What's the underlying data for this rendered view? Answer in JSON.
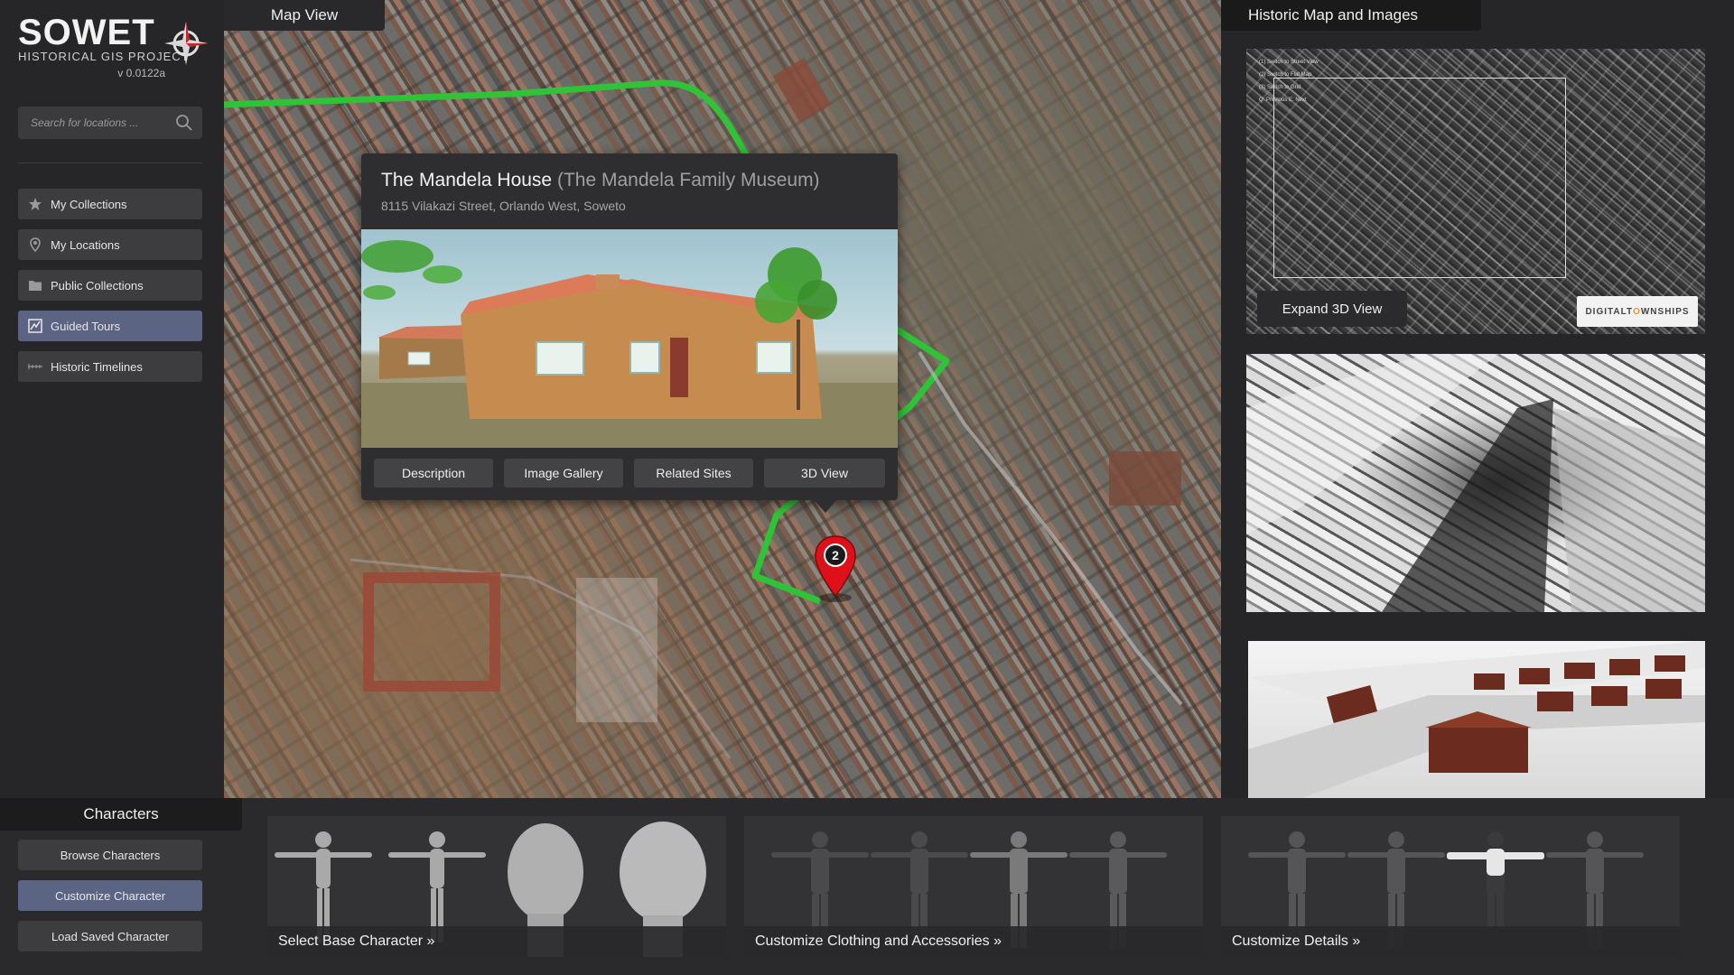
{
  "app": {
    "logo_title": "SOWET",
    "logo_subtitle": "HISTORICAL GIS PROJECT",
    "version": "v 0.0122a"
  },
  "search": {
    "placeholder": "Search for locations ..."
  },
  "sidebar": {
    "items": [
      {
        "label": "My Collections",
        "icon": "star-icon"
      },
      {
        "label": "My Locations",
        "icon": "map-pin-icon"
      },
      {
        "label": "Public Collections",
        "icon": "folder-icon"
      },
      {
        "label": "Guided Tours",
        "icon": "tour-icon",
        "active": true
      },
      {
        "label": "Historic Timelines",
        "icon": "timeline-icon"
      }
    ]
  },
  "map": {
    "tab_label": "Map View",
    "popup": {
      "title": "The Mandela House",
      "title_alt": "(The Mandela Family Museum)",
      "address": "8115 Vilakazi Street, Orlando West, Soweto",
      "tabs": [
        "Description",
        "Image Gallery",
        "Related Sites",
        "3D View"
      ]
    },
    "marker_number": "2",
    "route_color": "#2fc437"
  },
  "right_panel": {
    "title": "Historic Map  and Images",
    "expand_label": "Expand 3D View",
    "logo_text_a": "DIGITALT",
    "logo_text_o": "O",
    "logo_text_b": "WNSHIPS",
    "hints": [
      "(1) Switch to Street View",
      "(2) Switch to Flat Map",
      "(3) Switch to Grid",
      "Q: Previous      E: Next"
    ]
  },
  "characters": {
    "title": "Characters",
    "nav": [
      {
        "label": "Browse Characters"
      },
      {
        "label": "Customize Character",
        "active": true
      },
      {
        "label": "Load Saved Character"
      }
    ],
    "cards": [
      {
        "caption": "Select Base Character »"
      },
      {
        "caption": "Customize Clothing and Accessories »"
      },
      {
        "caption": "Customize Details »"
      }
    ]
  },
  "colors": {
    "accent": "#5b6583",
    "marker": "#e0101a",
    "panel": "#2e2e30"
  }
}
